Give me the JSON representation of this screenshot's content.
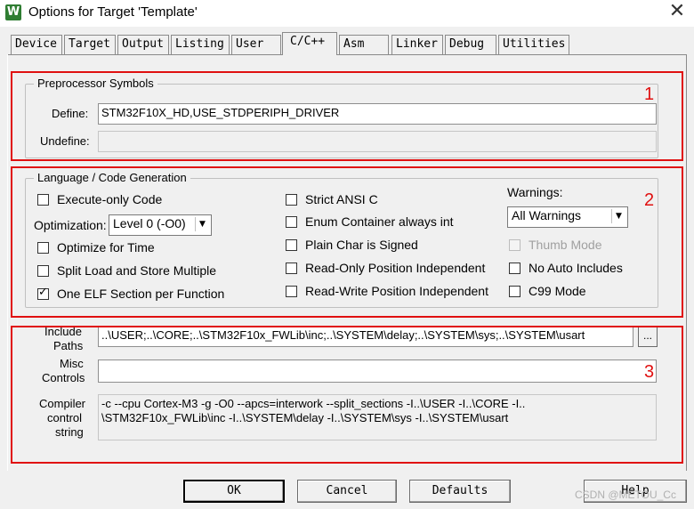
{
  "window": {
    "app_icon_glyph": "W",
    "title": "Options for Target 'Template'",
    "close_glyph": "✕"
  },
  "tabs": [
    {
      "label": "Device"
    },
    {
      "label": "Target"
    },
    {
      "label": "Output"
    },
    {
      "label": "Listing"
    },
    {
      "label": "User"
    },
    {
      "label": "C/C++"
    },
    {
      "label": "Asm"
    },
    {
      "label": "Linker"
    },
    {
      "label": "Debug"
    },
    {
      "label": "Utilities"
    }
  ],
  "active_tab": "C/C++",
  "annotations": {
    "box1": "1",
    "box2": "2",
    "box3": "3",
    "color": "#e01010"
  },
  "preprocessor": {
    "title": "Preprocessor Symbols",
    "define_label": "Define:",
    "define_value": "STM32F10X_HD,USE_STDPERIPH_DRIVER",
    "undefine_label": "Undefine:",
    "undefine_value": ""
  },
  "language": {
    "title": "Language / Code Generation",
    "execute_only": "Execute-only Code",
    "optimization_label": "Optimization:",
    "optimization_value": "Level 0 (-O0)",
    "optimize_time": "Optimize for Time",
    "split_load": "Split Load and Store Multiple",
    "one_elf": "One ELF Section per Function",
    "strict_ansi": "Strict ANSI C",
    "enum_container": "Enum Container always int",
    "plain_char": "Plain Char is Signed",
    "ro_position": "Read-Only Position Independent",
    "rw_position": "Read-Write Position Independent",
    "warnings_label": "Warnings:",
    "warnings_value": "All Warnings",
    "thumb_mode": "Thumb Mode",
    "no_auto_includes": "No Auto Includes",
    "c99_mode": "C99 Mode",
    "checked": {
      "one_elf": true
    }
  },
  "paths": {
    "include_label_1": "Include",
    "include_label_2": "Paths",
    "include_value": "..\\USER;..\\CORE;..\\STM32F10x_FWLib\\inc;..\\SYSTEM\\delay;..\\SYSTEM\\sys;..\\SYSTEM\\usart",
    "browse_label": "...",
    "misc_label_1": "Misc",
    "misc_label_2": "Controls",
    "misc_value": "",
    "compiler_label_1": "Compiler",
    "compiler_label_2": "control",
    "compiler_label_3": "string",
    "compiler_line_1": "-c --cpu Cortex-M3 -g -O0 --apcs=interwork --split_sections -I..\\USER -I..\\CORE -I..",
    "compiler_line_2": "\\STM32F10x_FWLib\\inc -I..\\SYSTEM\\delay -I..\\SYSTEM\\sys -I..\\SYSTEM\\usart"
  },
  "buttons": {
    "ok": "OK",
    "cancel": "Cancel",
    "defaults": "Defaults",
    "help": "Help"
  },
  "watermark": "CSDN @METOU_Cc"
}
